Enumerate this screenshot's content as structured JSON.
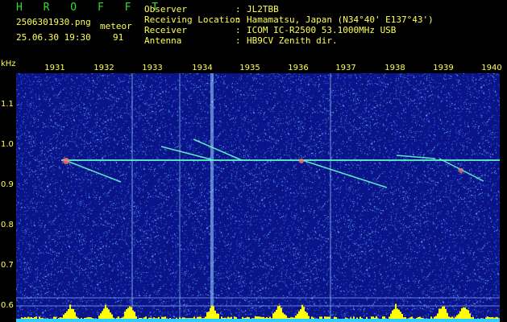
{
  "header": {
    "title": "H R O F F T",
    "filename": "2506301930.png",
    "datetime": "25.06.30 19:30",
    "meteor_label": "meteor",
    "meteor_count": "91",
    "fields": [
      {
        "label": "Observer",
        "value": "JL2TBB"
      },
      {
        "label": "Receiving Location",
        "value": "Hamamatsu, Japan (N34°40' E137°43')"
      },
      {
        "label": "Receiver",
        "value": "ICOM IC-R2500 53.1000MHz USB"
      },
      {
        "label": "Antenna",
        "value": "HB9CV Zenith dir."
      }
    ]
  },
  "axes": {
    "y_unit": "kHz",
    "x_ticks": [
      "1931",
      "1932",
      "1933",
      "1934",
      "1935",
      "1936",
      "1937",
      "1938",
      "1939",
      "1940"
    ],
    "y_ticks": [
      "1.1",
      "1.0",
      "0.9",
      "0.8",
      "0.7",
      "0.6"
    ]
  },
  "colors": {
    "background": "#0a1a8a",
    "text": "#ffff55",
    "title": "#33dd33",
    "signal": "#66ffcc",
    "histogram": "#ffff00"
  }
}
